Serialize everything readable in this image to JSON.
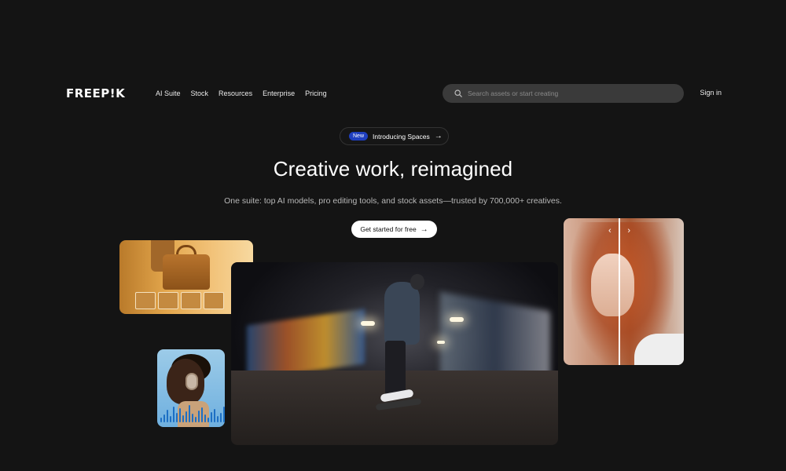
{
  "nav": {
    "logo": "FREEP!K",
    "links": [
      "AI Suite",
      "Stock",
      "Resources",
      "Enterprise",
      "Pricing"
    ],
    "search_placeholder": "Search assets or start creating",
    "sign_in": "Sign in"
  },
  "hero": {
    "badge_pill": "New",
    "badge_text": "Introducing Spaces",
    "title": "Creative work, reimagined",
    "subtitle": "One suite: top AI models, pro editing tools, and stock assets—trusted by 700,000+ creatives.",
    "cta": "Get started for free"
  },
  "icons": {
    "search": "search-icon",
    "arrow": "arrow-right-icon",
    "compare": "chevron-left-right-icon"
  },
  "colors": {
    "background": "#141414",
    "search_bg": "#3a3a3a",
    "badge_pill": "#1f3fbf",
    "cta_bg": "#ffffff"
  }
}
